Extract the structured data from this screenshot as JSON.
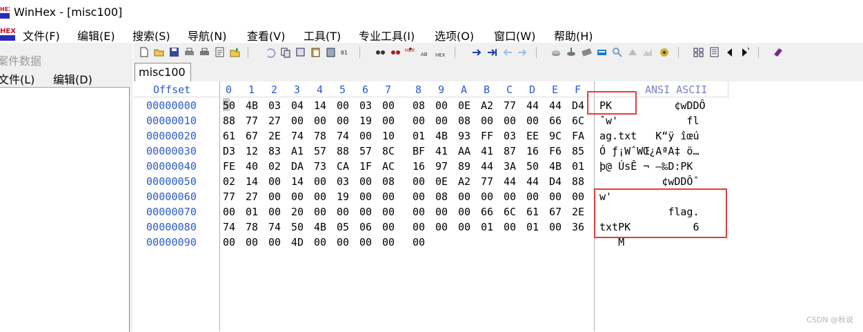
{
  "window": {
    "title": "WinHex - [misc100]"
  },
  "menubar": {
    "items": [
      "文件(F)",
      "编辑(E)",
      "搜索(S)",
      "导航(N)",
      "查看(V)",
      "工具(T)",
      "专业工具(I)",
      "选项(O)",
      "窗口(W)",
      "帮助(H)"
    ]
  },
  "case_panel": {
    "title": "案件数据",
    "menu": [
      "文件(L)",
      "编辑(D)"
    ]
  },
  "toolbar": {
    "icons": [
      "new-file-icon",
      "open-folder-icon",
      "save-icon",
      "print-icon",
      "print-setup-icon",
      "properties-icon",
      "export-icon",
      "undo-icon",
      "copy-block-icon",
      "cut-icon",
      "paste-icon",
      "paste-special-icon",
      "copy-hex-icon",
      "find-text-icon",
      "find-hex-icon",
      "replace-text-icon",
      "replace-hex-icon",
      "find-integer-icon",
      "goto-offset-icon",
      "goto-sector-icon",
      "back-icon",
      "forward-icon",
      "open-disk-icon",
      "disk-tools-icon",
      "ram-editor-icon",
      "calculator-icon",
      "zoom-icon",
      "hash-icon",
      "analysis-icon",
      "hex-converter-icon",
      "view-mode-icon",
      "data-interpreter-icon",
      "previous-icon",
      "next-icon",
      "help-book-icon"
    ]
  },
  "tabs": [
    {
      "label": "misc100",
      "active": true
    }
  ],
  "hex_view": {
    "offset_header": "Offset",
    "column_headers": [
      "0",
      "1",
      "2",
      "3",
      "4",
      "5",
      "6",
      "7",
      "8",
      "9",
      "A",
      "B",
      "C",
      "D",
      "E",
      "F"
    ],
    "ansi_header": "ANSI ASCII",
    "rows": [
      {
        "offset": "00000000",
        "bytes": [
          "50",
          "4B",
          "03",
          "04",
          "14",
          "00",
          "03",
          "00",
          "08",
          "00",
          "0E",
          "A2",
          "77",
          "44",
          "44",
          "D4"
        ],
        "ascii": "PK          ¢wDDÔ"
      },
      {
        "offset": "00000010",
        "bytes": [
          "88",
          "77",
          "27",
          "00",
          "00",
          "00",
          "19",
          "00",
          "00",
          "00",
          "08",
          "00",
          "00",
          "00",
          "66",
          "6C"
        ],
        "ascii": "ˆw'           fl"
      },
      {
        "offset": "00000020",
        "bytes": [
          "61",
          "67",
          "2E",
          "74",
          "78",
          "74",
          "00",
          "10",
          "01",
          "4B",
          "93",
          "FF",
          "03",
          "EE",
          "9C",
          "FA"
        ],
        "ascii": "ag.txt   K“ÿ îœú"
      },
      {
        "offset": "00000030",
        "bytes": [
          "D3",
          "12",
          "83",
          "A1",
          "57",
          "88",
          "57",
          "8C",
          "BF",
          "41",
          "AA",
          "41",
          "87",
          "16",
          "F6",
          "85"
        ],
        "ascii": "Ó ƒ¡WˆWŒ¿AªA‡ ö…"
      },
      {
        "offset": "00000040",
        "bytes": [
          "FE",
          "40",
          "02",
          "DA",
          "73",
          "CA",
          "1F",
          "AC",
          "16",
          "97",
          "89",
          "44",
          "3A",
          "50",
          "4B",
          "01"
        ],
        "ascii": "þ@ ÚsÊ ¬ —‰D:PK"
      },
      {
        "offset": "00000050",
        "bytes": [
          "02",
          "14",
          "00",
          "14",
          "00",
          "03",
          "00",
          "08",
          "00",
          "0E",
          "A2",
          "77",
          "44",
          "44",
          "D4",
          "88"
        ],
        "ascii": "          ¢wDDÔˆ"
      },
      {
        "offset": "00000060",
        "bytes": [
          "77",
          "27",
          "00",
          "00",
          "00",
          "19",
          "00",
          "00",
          "00",
          "08",
          "00",
          "00",
          "00",
          "00",
          "00",
          "00"
        ],
        "ascii": "w'"
      },
      {
        "offset": "00000070",
        "bytes": [
          "00",
          "01",
          "00",
          "20",
          "00",
          "00",
          "00",
          "00",
          "00",
          "00",
          "00",
          "66",
          "6C",
          "61",
          "67",
          "2E"
        ],
        "ascii": "           flag."
      },
      {
        "offset": "00000080",
        "bytes": [
          "74",
          "78",
          "74",
          "50",
          "4B",
          "05",
          "06",
          "00",
          "00",
          "00",
          "00",
          "01",
          "00",
          "01",
          "00",
          "36"
        ],
        "ascii": "txtPK          6"
      },
      {
        "offset": "00000090",
        "bytes": [
          "00",
          "00",
          "00",
          "4D",
          "00",
          "00",
          "00",
          "00",
          "00"
        ],
        "ascii": "   M"
      }
    ]
  },
  "watermark": "CSDN @秋说",
  "colors": {
    "offset_blue": "#2a5ad0",
    "highlight_red": "#e53a3a"
  }
}
